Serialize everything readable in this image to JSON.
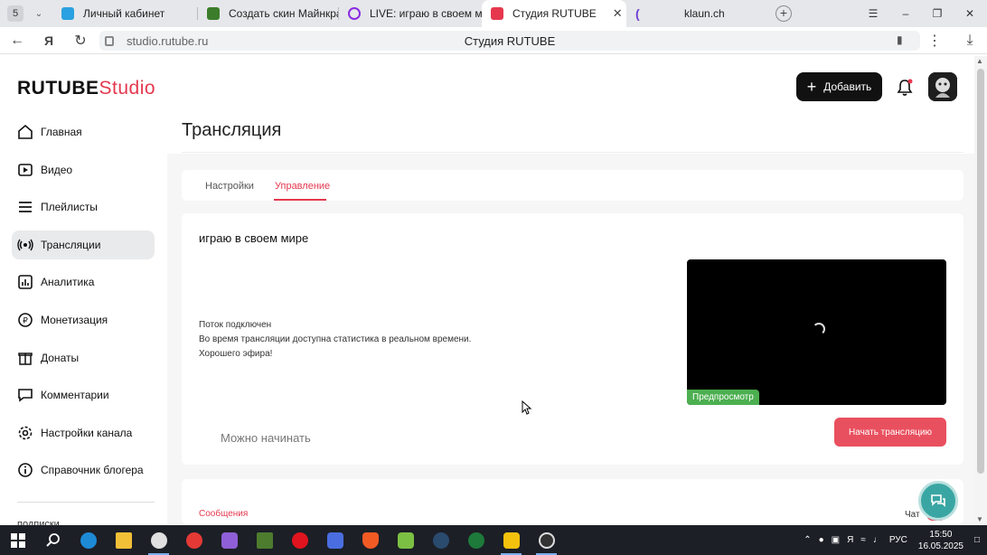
{
  "browser": {
    "tab_count": "5",
    "tabs": [
      {
        "label": "Личный кабинет",
        "color": "#2aa1e0"
      },
      {
        "label": "Создать скин Майнкрафт",
        "color": "#3b7d2a"
      },
      {
        "label": "LIVE: играю в своем мир",
        "color": "#8a2be2"
      },
      {
        "label": "Студия RUTUBE",
        "color": "#e5384e"
      },
      {
        "label": "klaun.ch",
        "color": "#6b3fd1"
      }
    ],
    "url": "studio.rutube.ru",
    "page_title": "Студия RUTUBE"
  },
  "header": {
    "logo_main": "RUTUBE",
    "logo_sub": "Studio",
    "add_button": "Добавить"
  },
  "sidebar": {
    "items": [
      {
        "label": "Главная",
        "icon": "home-icon"
      },
      {
        "label": "Видео",
        "icon": "video-icon"
      },
      {
        "label": "Плейлисты",
        "icon": "playlist-icon"
      },
      {
        "label": "Трансляции",
        "icon": "broadcast-icon"
      },
      {
        "label": "Аналитика",
        "icon": "analytics-icon"
      },
      {
        "label": "Монетизация",
        "icon": "monetization-icon"
      },
      {
        "label": "Донаты",
        "icon": "donate-icon"
      },
      {
        "label": "Комментарии",
        "icon": "comments-icon"
      },
      {
        "label": "Настройки канала",
        "icon": "settings-icon"
      },
      {
        "label": "Справочник блогера",
        "icon": "info-icon"
      }
    ],
    "active_index": 3,
    "more": "подписки"
  },
  "main": {
    "title": "Трансляция",
    "tabs": [
      "Настройки",
      "Управление"
    ],
    "active_tab": 1,
    "stream_name": "играю в своем мире",
    "status_title": "Поток подключен",
    "status_line1": "Во время трансляции доступна статистика в реальном времени.",
    "status_line2": "Хорошего эфира!",
    "preview_badge": "Предпросмотр",
    "ready_text": "Можно начинать",
    "start_button": "Начать трансляцию",
    "messages_label": "Сообщения",
    "chat_label": "Чат"
  },
  "taskbar": {
    "lang": "РУС",
    "time": "15:50",
    "date": "16.05.2025"
  },
  "colors": {
    "accent": "#e5384e",
    "preview_badge": "#4caf50",
    "start_button": "#e9505f"
  }
}
